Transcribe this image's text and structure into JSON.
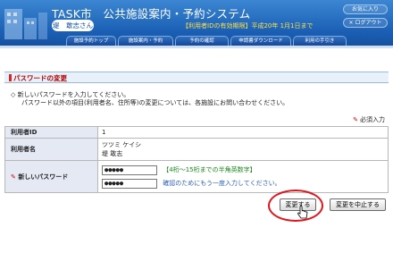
{
  "header": {
    "title": "TASK市　公共施設案内・予約システム",
    "user": "堤　敢志さん",
    "favorites": "お気に入り",
    "logout": "× ログアウト",
    "notice": "【利用者IDの有効期限】平成20年 1月1日まで"
  },
  "nav": [
    {
      "label": "施設予約トップ"
    },
    {
      "label": "施設案内・予約"
    },
    {
      "label": "予約の確認"
    },
    {
      "label": "申請書ダウンロード"
    },
    {
      "label": "利用の手引き"
    }
  ],
  "section_title": "パスワードの変更",
  "instructions": {
    "line1": "新しいパスワードを入力してください。",
    "line2": "パスワード以外の項目(利用者名、住所等)の変更については、各施設にお問い合わせください。"
  },
  "required_note": "必須入力",
  "form": {
    "user_id_label": "利用者ID",
    "user_id_value": "1",
    "user_name_label": "利用者名",
    "user_name_kana": "ツツミ ケイシ",
    "user_name_kanji": "堤 敢志",
    "new_password_label": "新しいパスワード",
    "password_value": "●●●●●",
    "password_hint": "【4桁～15桁までの半角英数字】",
    "confirm_value": "●●●●●",
    "confirm_hint": "確認のためにもう一度入力してください。"
  },
  "buttons": {
    "change": "変更する",
    "cancel": "変更を中止する"
  },
  "colors": {
    "header_blue": "#1a5fb4",
    "notice_yellow": "#ffe14a",
    "section_red": "#b00000",
    "hint_green": "#1a8a1a",
    "highlight_circle": "#e0141a"
  }
}
